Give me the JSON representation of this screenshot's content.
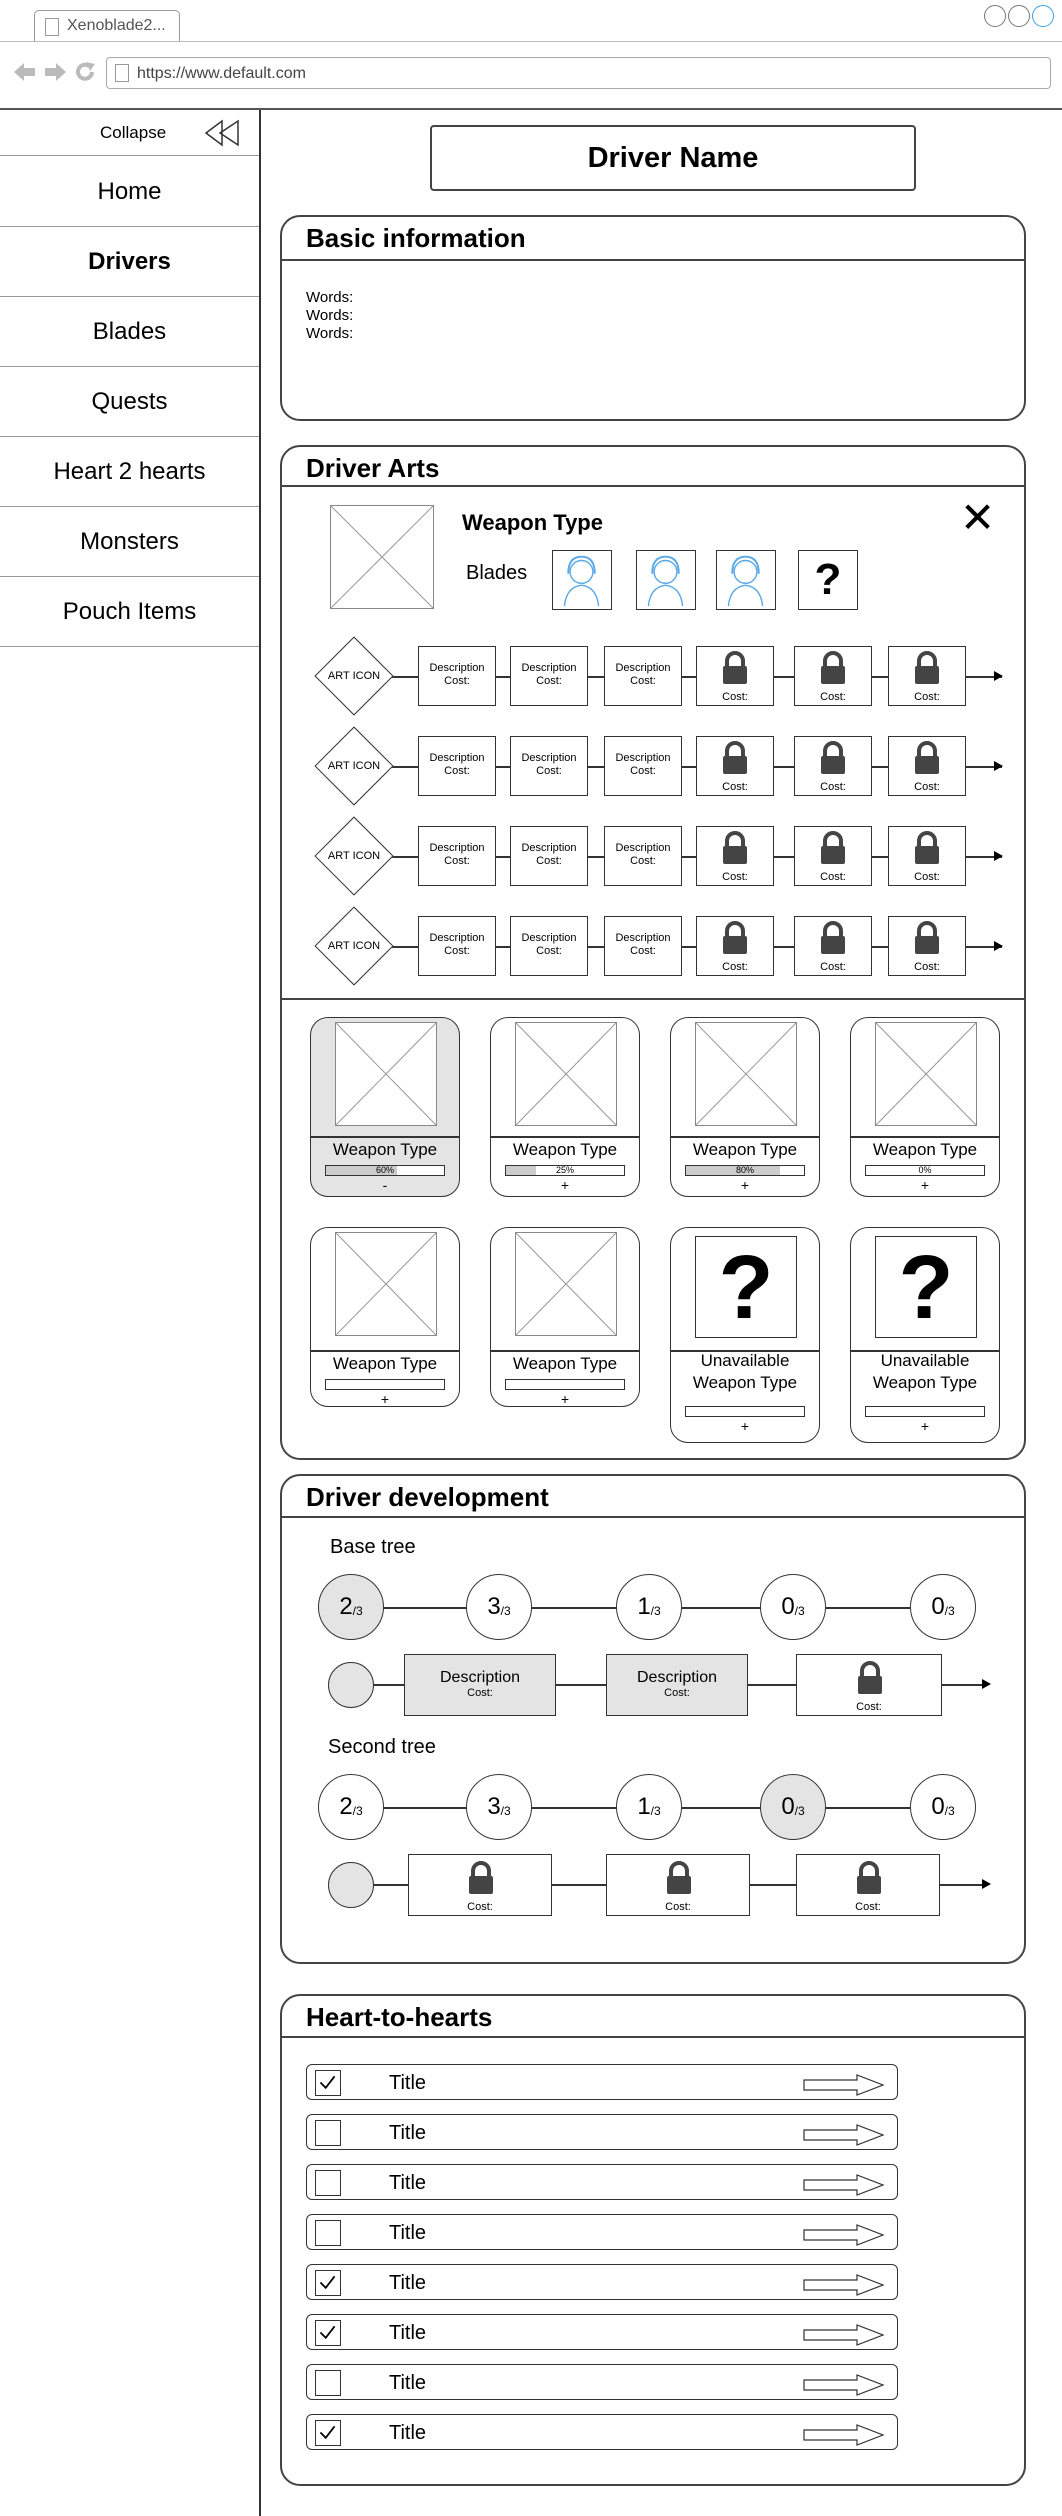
{
  "browser": {
    "tab_title": "Xenoblade2...",
    "url": "https://www.default.com"
  },
  "sidebar": {
    "collapse_label": "Collapse",
    "items": [
      {
        "label": "Home",
        "active": false
      },
      {
        "label": "Drivers",
        "active": true
      },
      {
        "label": "Blades",
        "active": false
      },
      {
        "label": "Quests",
        "active": false
      },
      {
        "label": "Heart 2 hearts",
        "active": false
      },
      {
        "label": "Monsters",
        "active": false
      },
      {
        "label": "Pouch Items",
        "active": false
      }
    ]
  },
  "driver_name": "Driver Name",
  "basic_info": {
    "title": "Basic information",
    "lines": [
      "Words:",
      "Words:",
      "Words:"
    ]
  },
  "driver_arts": {
    "title": "Driver Arts",
    "weapon_type": "Weapon Type",
    "blades_label": "Blades",
    "unknown_blade_glyph": "?",
    "close_glyph": "✕",
    "art_icon_label": "ART ICON",
    "description_label": "Description",
    "cost_label": "Cost:",
    "rows": 4,
    "weapons": [
      {
        "label": "Weapon Type",
        "progress_text": "60%",
        "progress": 0.6,
        "action": "-",
        "selected": true
      },
      {
        "label": "Weapon Type",
        "progress_text": "25%",
        "progress": 0.25,
        "action": "+",
        "selected": false
      },
      {
        "label": "Weapon Type",
        "progress_text": "80%",
        "progress": 0.8,
        "action": "+",
        "selected": false
      },
      {
        "label": "Weapon Type",
        "progress_text": "0%",
        "progress": 0,
        "action": "+",
        "selected": false
      },
      {
        "label": "Weapon Type",
        "progress_text": "",
        "progress": 0,
        "action": "+",
        "selected": false
      },
      {
        "label": "Weapon Type",
        "progress_text": "",
        "progress": 0,
        "action": "+",
        "selected": false
      },
      {
        "label": "Unavailable Weapon Type",
        "progress_text": "",
        "progress": 0,
        "action": "+",
        "selected": false,
        "unknown": true
      },
      {
        "label": "Unavailable Weapon Type",
        "progress_text": "",
        "progress": 0,
        "action": "+",
        "selected": false,
        "unknown": true
      }
    ]
  },
  "driver_development": {
    "title": "Driver development",
    "base_tree": {
      "label": "Base tree",
      "levels": [
        {
          "value": "2",
          "max": "/3",
          "filled": true
        },
        {
          "value": "3",
          "max": "/3",
          "filled": false
        },
        {
          "value": "1",
          "max": "/3",
          "filled": false
        },
        {
          "value": "0",
          "max": "/3",
          "filled": false
        },
        {
          "value": "0",
          "max": "/3",
          "filled": false
        }
      ],
      "nodes": [
        {
          "desc": "Description",
          "cost": "Cost:"
        },
        {
          "desc": "Description",
          "cost": "Cost:"
        },
        {
          "locked": true,
          "cost": "Cost:"
        }
      ]
    },
    "second_tree": {
      "label": "Second tree",
      "levels": [
        {
          "value": "2",
          "max": "/3",
          "filled": false
        },
        {
          "value": "3",
          "max": "/3",
          "filled": false
        },
        {
          "value": "1",
          "max": "/3",
          "filled": false
        },
        {
          "value": "0",
          "max": "/3",
          "filled": true
        },
        {
          "value": "0",
          "max": "/3",
          "filled": false
        }
      ],
      "nodes": [
        {
          "locked": true,
          "cost": "Cost:"
        },
        {
          "locked": true,
          "cost": "Cost:"
        },
        {
          "locked": true,
          "cost": "Cost:"
        }
      ]
    }
  },
  "heart_to_hearts": {
    "title": "Heart-to-hearts",
    "items": [
      {
        "title": "Title",
        "checked": true
      },
      {
        "title": "Title",
        "checked": false
      },
      {
        "title": "Title",
        "checked": false
      },
      {
        "title": "Title",
        "checked": false
      },
      {
        "title": "Title",
        "checked": true
      },
      {
        "title": "Title",
        "checked": true
      },
      {
        "title": "Title",
        "checked": false
      },
      {
        "title": "Title",
        "checked": true
      }
    ]
  }
}
